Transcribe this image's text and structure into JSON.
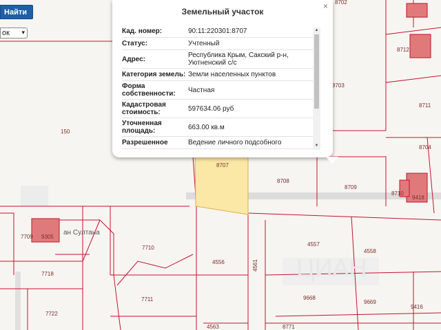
{
  "search": {
    "find_label": "Найти",
    "type_value": "ок"
  },
  "popup": {
    "title": "Земельный участок",
    "close_glyph": "×",
    "rows": [
      {
        "key": "Кад. номер:",
        "value": "90:11:220301:8707"
      },
      {
        "key": "Статус:",
        "value": "Учтенный"
      },
      {
        "key": "Адрес:",
        "value": "Республика Крым, Сакский р-н, Уютненский с/с"
      },
      {
        "key": "Категория земель:",
        "value": "Земли населенных пунктов"
      },
      {
        "key": "Форма собственности:",
        "value": "Частная"
      },
      {
        "key": "Кадастровая стоимость:",
        "value": "597634.06 руб"
      },
      {
        "key": "Уточненная площадь:",
        "value": "663.00 кв.м"
      },
      {
        "key": "Разрешенное",
        "value": "Ведение личного подсобного"
      }
    ]
  },
  "map": {
    "street_name": "ан Султана",
    "parcels": [
      "8707",
      "8704",
      "8703",
      "8708",
      "8709",
      "8710",
      "9418",
      "8711",
      "8712",
      "150",
      "7710",
      "4557",
      "4558",
      "4556",
      "4561",
      "9668",
      "9669",
      "9416",
      "7711",
      "7718",
      "7722",
      "7709",
      "9305",
      "4563",
      "8702",
      "8771"
    ],
    "colors": {
      "selected_fill": "#fbe7a6",
      "boundary": "#c8102e",
      "building": "#e07a7a"
    }
  }
}
